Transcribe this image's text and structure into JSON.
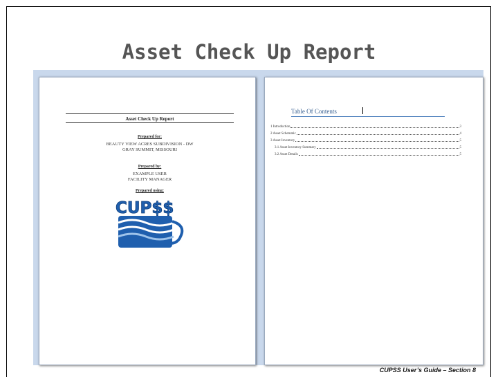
{
  "slide": {
    "title": "Asset Check Up Report",
    "footer": "CUPSS User’s Guide – Section 8"
  },
  "cover_page": {
    "report_title": "Asset Check Up Report",
    "prepared_for_label": "Prepared for:",
    "prepared_for_lines": [
      "BEAUTY VIEW ACRES SUBDIVISION - DW",
      "GRAY SUMMIT, MISSOURI"
    ],
    "prepared_by_label": "Prepared by:",
    "prepared_by_lines": [
      "EXAMPLE USER",
      "FACILITY MANAGER"
    ],
    "prepared_using_label": "Prepared using:",
    "logo_text": "CUP$$"
  },
  "toc_page": {
    "title": "Table Of Contents",
    "entries": [
      {
        "text": "1 Introduction",
        "page": "3"
      },
      {
        "text": "2 Asset Schematic",
        "page": "4"
      },
      {
        "text": "3 Asset Inventory",
        "page": "5"
      },
      {
        "text": "3.1   Asset Inventory Summary",
        "page": "5"
      },
      {
        "text": "3.2   Asset Details",
        "page": "5"
      }
    ]
  },
  "colors": {
    "workspace": "#c9d8ec",
    "toc_heading": "#365f91",
    "logo_blue": "#1f5fae"
  }
}
